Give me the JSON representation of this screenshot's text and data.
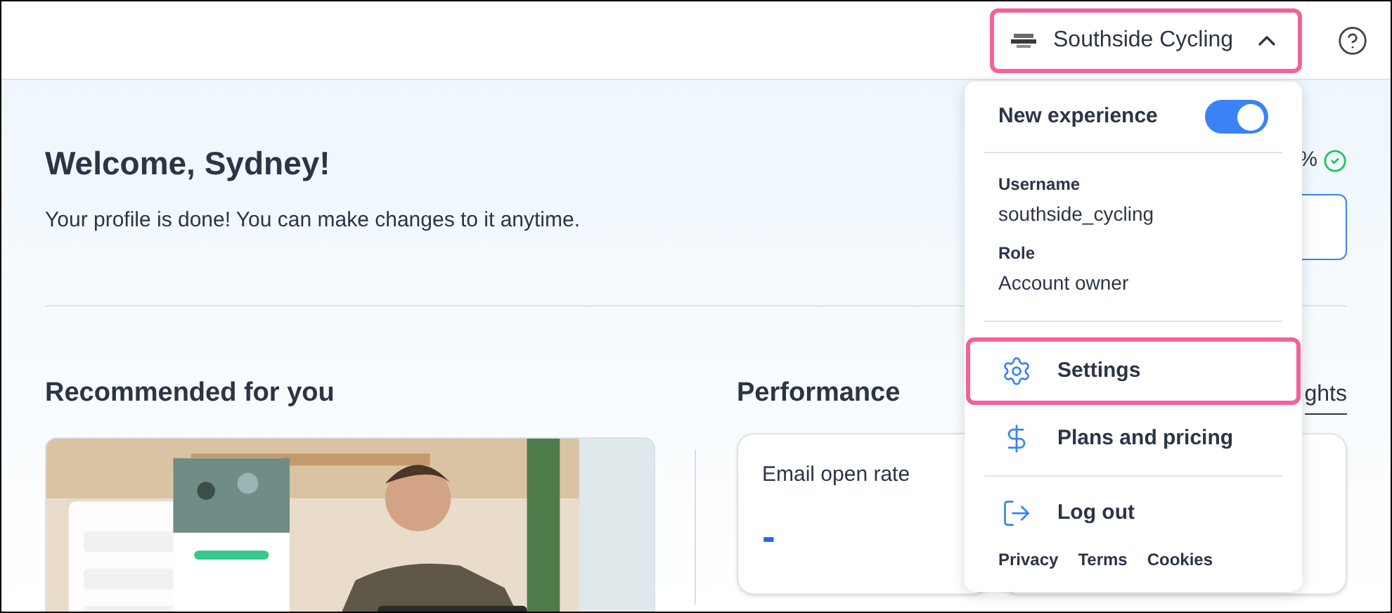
{
  "header": {
    "account": {
      "name": "Southside Cycling",
      "expanded": true,
      "highlighted": true
    }
  },
  "welcome": {
    "title": "Welcome, Sydney!",
    "subtitle": "Your profile is done! You can make changes to it anytime.",
    "progress": "%",
    "complete": true
  },
  "recommended": {
    "title": "Recommended for you"
  },
  "performance": {
    "title": "Performance",
    "link": "ghts",
    "cards": [
      {
        "label": "Email open rate",
        "value": "-"
      }
    ]
  },
  "menu": {
    "toggle": {
      "label": "New experience",
      "on": true
    },
    "fields": [
      {
        "label": "Username",
        "value": "southside_cycling"
      },
      {
        "label": "Role",
        "value": "Account owner"
      }
    ],
    "items": [
      {
        "kind": "gear",
        "label": "Settings",
        "highlighted": true,
        "divider_after": false
      },
      {
        "kind": "dollar",
        "label": "Plans and pricing",
        "highlighted": false,
        "divider_after": true
      },
      {
        "kind": "logout",
        "label": "Log out",
        "highlighted": false,
        "divider_after": false
      }
    ],
    "footer": [
      "Privacy",
      "Terms",
      "Cookies"
    ]
  }
}
